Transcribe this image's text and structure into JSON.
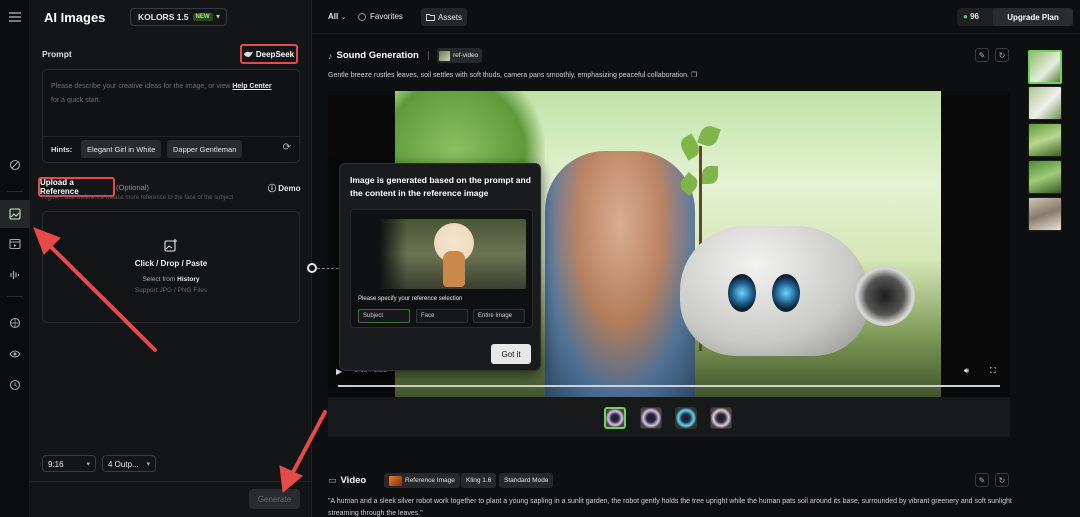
{
  "rail": {
    "icons": [
      "menu-icon",
      "effects-icon",
      "image-icon",
      "video-icon",
      "audio-icon",
      "models-icon",
      "community-icon",
      "history-icon"
    ]
  },
  "panel": {
    "title": "AI Images",
    "model": "KOLORS 1.5",
    "model_badge": "NEW",
    "prompt_label": "Prompt",
    "deepseek_label": "DeepSeek",
    "prompt_placeholder_a": "Please describe your creative ideas for the image, or view ",
    "help_center": "Help Center",
    "prompt_placeholder_b": "for a quick start.",
    "hints_label": "Hints:",
    "hints": [
      "Elegant Girl in White",
      "Dapper Gentleman"
    ],
    "upload_ref": "Upload a Reference",
    "optional": "(Optional)",
    "subnote": "Higher Face Reference means more reference to the face of the subject",
    "demo": "Demo",
    "drop_title": "Click / Drop / Paste",
    "drop_select_a": "Select from ",
    "drop_history": "History",
    "drop_support": "Support JPG / PNG Files",
    "ratio": "9:16",
    "outputs": "4 Outp...",
    "generate": "Generate"
  },
  "topbar": {
    "all": "All",
    "favorites": "Favorites",
    "assets": "Assets",
    "credits": "96",
    "upgrade": "Upgrade Plan"
  },
  "sound": {
    "title": "Sound Generation",
    "tag": "ref-video",
    "description": "Gentle breeze rustles leaves, soil settles with soft thuds, camera pans smoothly, emphasizing peaceful collaboration.",
    "time": "0:02 / 0:05"
  },
  "tooltip": {
    "title": "Image is generated based on the prompt and the content in the reference image",
    "question": "Please specify your reference selection",
    "options": [
      "Subject",
      "Face",
      "Entire Image"
    ],
    "got_it": "Got it"
  },
  "video": {
    "title": "Video",
    "chips": [
      "Reference Image",
      "Kling 1.6",
      "Standard Mode"
    ],
    "description": "\"A human and a sleek silver robot work together to plant a young sapling in a sunlit garden, the robot gently holds the tree upright while the human pats soil around its base, surrounded by vibrant greenery and soft sunlight streaming through the leaves.\""
  }
}
